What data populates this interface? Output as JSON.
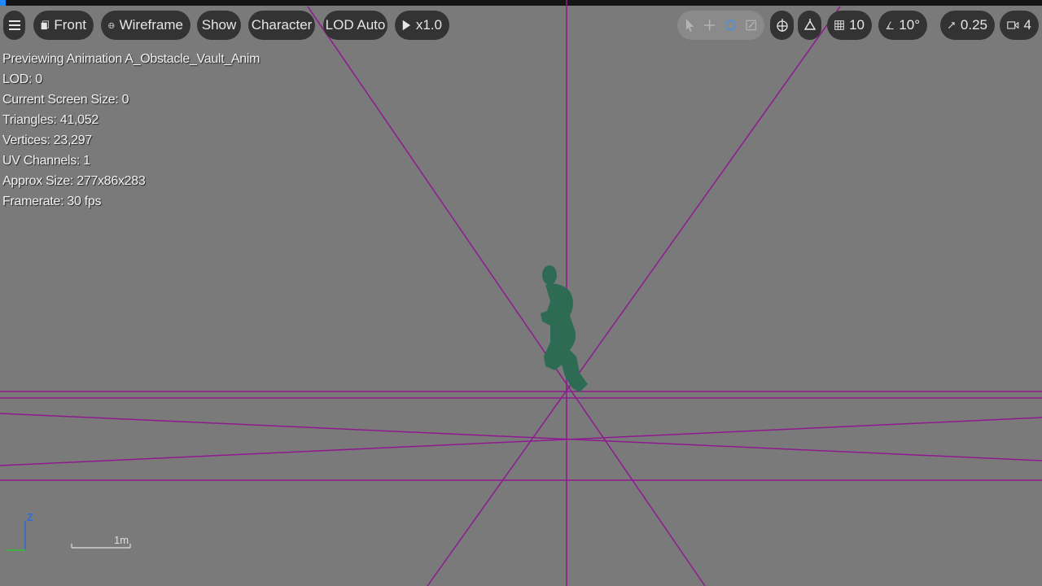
{
  "toolbar": {
    "menu_icon": "hamburger-icon",
    "view_label": "Front",
    "viewmode_label": "Wireframe",
    "show_label": "Show",
    "character_label": "Character",
    "lod_label": "LOD Auto",
    "playback_label": "x1.0",
    "grid_snap_value": "10",
    "rotation_snap_value": "10°",
    "scale_snap_value": "0.25",
    "camera_speed_value": "4"
  },
  "stats": {
    "line1": "Previewing Animation A_Obstacle_Vault_Anim",
    "line2": "LOD: 0",
    "line3": "Current Screen Size: 0",
    "line4": "Triangles: 41,052",
    "line5": "Vertices: 23,297",
    "line6": "UV Channels: 1",
    "line7": "Approx Size: 277x86x283",
    "line8": "Framerate: 30 fps"
  },
  "axis": {
    "z_label": "Z"
  },
  "scale_bar": {
    "label": "1m"
  },
  "colors": {
    "viewport_bg": "#7a7a7a",
    "wire": "#8f1a8f",
    "character": "#2e6b55",
    "toolbar_bg": "#333333"
  }
}
